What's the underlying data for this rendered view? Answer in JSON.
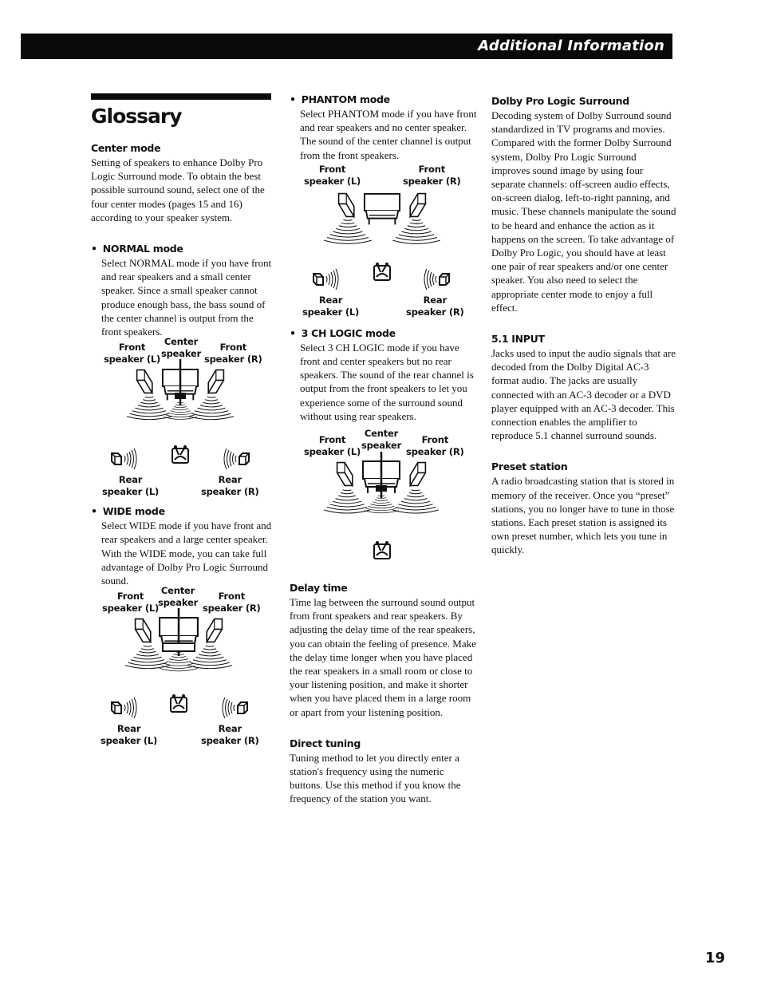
{
  "header": {
    "section_title": "Additional Information"
  },
  "page_title": "Glossary",
  "page_number": "19",
  "speaker_labels": {
    "front_l_1": "Front",
    "front_l_2": "speaker (L)",
    "front_r_1": "Front",
    "front_r_2": "speaker (R)",
    "center_1": "Center",
    "center_2": "speaker",
    "rear_l_1": "Rear",
    "rear_l_2": "speaker (L)",
    "rear_r_1": "Rear",
    "rear_r_2": "speaker (R)"
  },
  "entries": {
    "center_mode": {
      "term": "Center mode",
      "definition": "Setting of speakers to enhance Dolby Pro Logic Surround mode.  To obtain the best possible surround sound, select one of the four center modes (pages 15 and 16) according to your speaker system."
    },
    "normal_mode": {
      "term": "NORMAL mode",
      "definition": "Select NORMAL mode if you have front and rear speakers and a small center speaker.  Since a small speaker cannot produce enough bass, the bass sound of the center channel is output from the front speakers."
    },
    "wide_mode": {
      "term": "WIDE mode",
      "definition": "Select WIDE mode if you have front and rear speakers and a large center speaker.  With the WIDE mode, you can take full advantage of Dolby Pro Logic Surround sound."
    },
    "phantom_mode": {
      "term": "PHANTOM mode",
      "definition": "Select PHANTOM mode if you have front and rear speakers and no center speaker.  The sound of the center channel is output from the front speakers."
    },
    "three_ch_logic_mode": {
      "term": "3 CH LOGIC mode",
      "definition": "Select 3 CH LOGIC mode if you have front and center speakers but no rear speakers.  The sound of the rear channel is output from the front speakers to let you experience some of the surround sound without using rear speakers."
    },
    "delay_time": {
      "term": "Delay time",
      "definition": "Time lag between the surround sound output from front speakers and rear speakers.  By adjusting the delay time of the rear speakers, you can obtain the feeling of presence.  Make the delay time longer when you have placed the rear speakers in a small room or close to your listening position, and make it shorter when you have placed them in a large room or apart from your listening position."
    },
    "direct_tuning": {
      "term": "Direct tuning",
      "definition": "Tuning method to let you directly enter a station's frequency using the numeric buttons.  Use this method if you know the frequency of the station you want."
    },
    "dolby_pro_logic": {
      "term": "Dolby Pro Logic Surround",
      "definition": "Decoding system of Dolby Surround sound standardized in TV programs and movies.  Compared with the former Dolby Surround system, Dolby Pro Logic Surround improves sound image by using four separate channels: off-screen audio effects, on-screen dialog, left-to-right panning, and music.  These channels manipulate the sound to be heard and enhance the action as it happens on the screen.  To take advantage of Dolby Pro Logic, you should have at least one pair of rear speakers and/or one center speaker.  You also need to select the appropriate center mode to enjoy a full effect."
    },
    "input_5_1": {
      "term": "5.1 INPUT",
      "definition": "Jacks used to input the audio signals that are decoded from the Dolby Digital AC-3 format audio.  The jacks are usually connected with an AC-3 decoder or a DVD player equipped with an AC-3 decoder.  This connection enables the amplifier to reproduce 5.1 channel surround sounds."
    },
    "preset_station": {
      "term": "Preset station",
      "definition": "A radio broadcasting station that is stored in memory of the receiver.  Once you “preset” stations, you no longer have to tune in those stations.  Each preset station is assigned its own preset number, which lets you tune in quickly."
    }
  }
}
